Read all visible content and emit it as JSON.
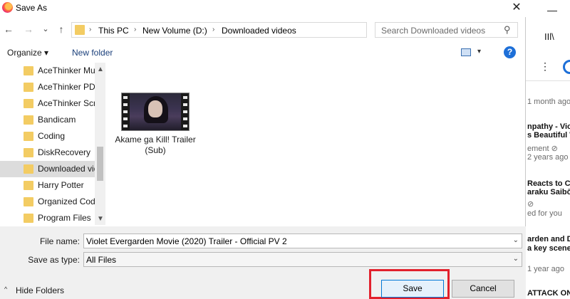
{
  "window": {
    "title": "Save As",
    "close_glyph": "✕"
  },
  "nav": {
    "back_glyph": "←",
    "forward_glyph": "→",
    "dropdown_glyph": "⌄",
    "up_glyph": "↑",
    "breadcrumbs": [
      "This PC",
      "New Volume (D:)",
      "Downloaded videos"
    ],
    "separator_glyph": "›",
    "refresh_glyph": "↻"
  },
  "search": {
    "placeholder": "Search Downloaded videos",
    "icon": "search-icon"
  },
  "toolbar": {
    "organize_label": "Organize ▾",
    "new_folder_label": "New folder",
    "view_dropdown_glyph": "▾",
    "help_label": "?"
  },
  "sidebar": {
    "items": [
      {
        "label": "AceThinker Music Keeper"
      },
      {
        "label": "AceThinker PDF Converter"
      },
      {
        "label": "AceThinker Screen Grabber"
      },
      {
        "label": "Bandicam"
      },
      {
        "label": "Coding"
      },
      {
        "label": "DiskRecovery"
      },
      {
        "label": "Downloaded videos"
      },
      {
        "label": "Harry Potter"
      },
      {
        "label": "Organized Code"
      },
      {
        "label": "Program Files"
      }
    ],
    "scroll_up_glyph": "▲",
    "scroll_down_glyph": "▼"
  },
  "files": [
    {
      "name": "Akame ga Kill! Trailer (Sub)",
      "thumb_caption": ""
    }
  ],
  "form": {
    "file_name_label": "File name:",
    "file_name_value": "Violet Evergarden Movie (2020) Trailer - Official PV 2",
    "save_as_type_label": "Save as type:",
    "save_as_type_value": "All Files",
    "dropdown_glyph": "⌄"
  },
  "footer": {
    "hide_folders_caret": "^",
    "hide_folders_label": "Hide Folders",
    "save_label": "Save",
    "cancel_label": "Cancel"
  },
  "background_app": {
    "texts": [
      {
        "text": "—",
        "muted": false
      },
      {
        "text": "IIl\\",
        "muted": false
      },
      {
        "text": "⋮",
        "muted": false
      },
      {
        "text": "1 month ago",
        "muted": true
      },
      {
        "text": "npathy - Viol",
        "muted": false
      },
      {
        "text": "s Beautiful W",
        "muted": false
      },
      {
        "text": "ement ⊘",
        "muted": true
      },
      {
        "text": "2 years ago",
        "muted": true
      },
      {
        "text": "Reacts to Cl",
        "muted": false
      },
      {
        "text": "araku Saibō)",
        "muted": false
      },
      {
        "text": "⊘",
        "muted": true
      },
      {
        "text": "ed for you",
        "muted": true
      },
      {
        "text": "arden and D",
        "muted": false
      },
      {
        "text": "a key scene",
        "muted": false
      },
      {
        "text": "1 year ago",
        "muted": true
      },
      {
        "text": "ATTACK ON",
        "muted": false
      }
    ]
  },
  "colors": {
    "highlight_border": "#e2202c",
    "folder": "#f3cc63",
    "accent": "#0078d7"
  }
}
